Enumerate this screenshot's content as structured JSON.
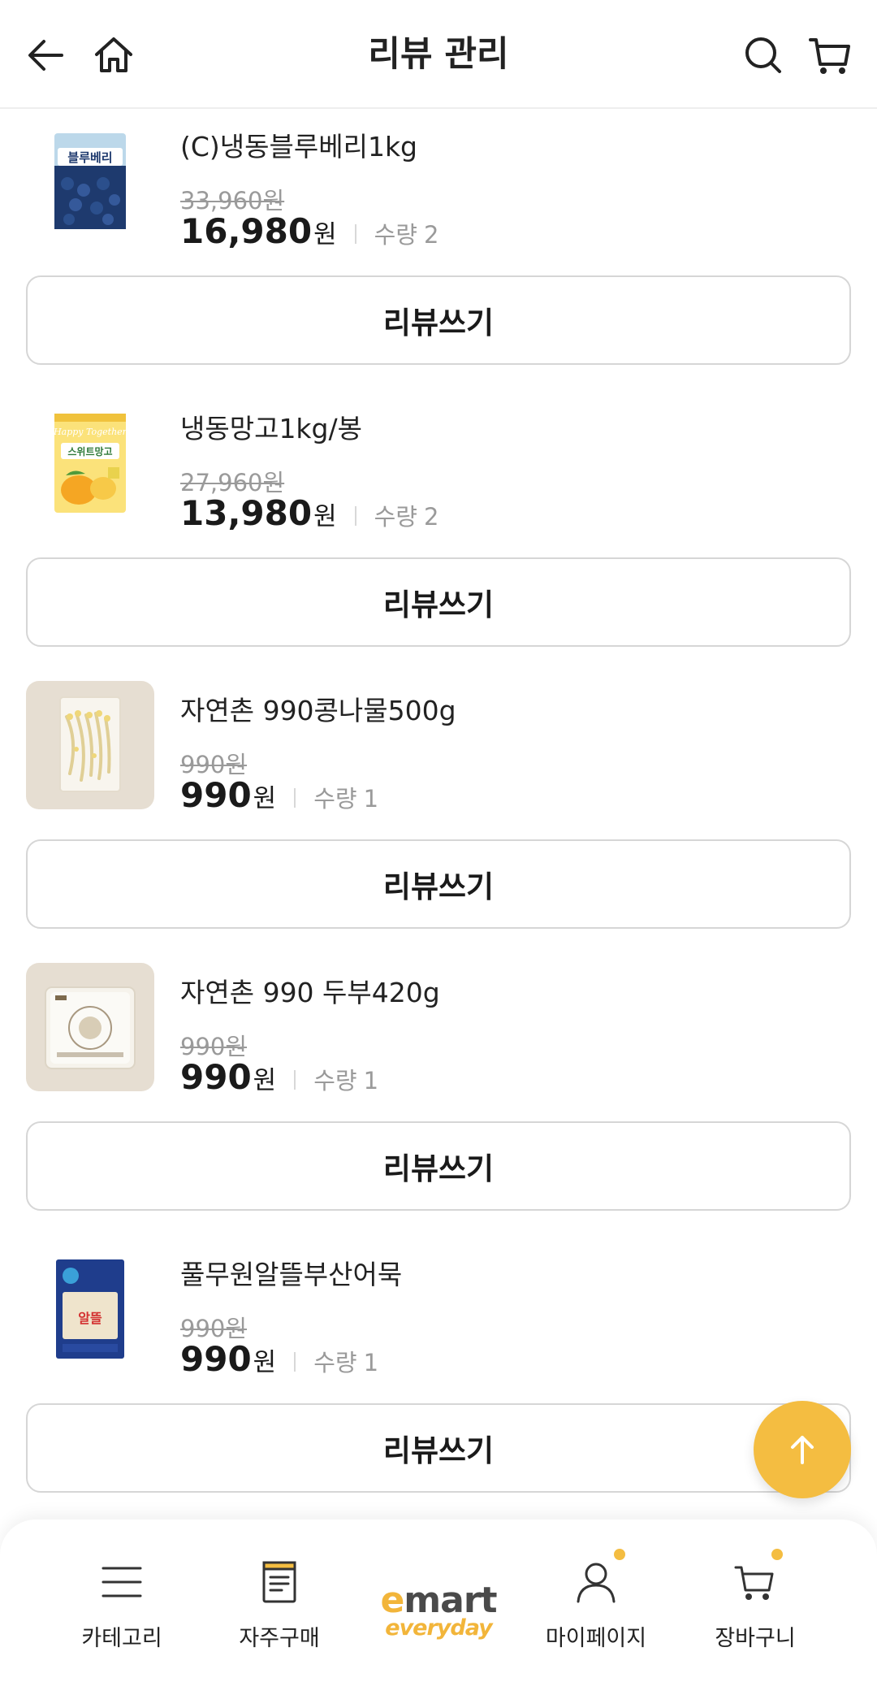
{
  "header": {
    "title": "리뷰 관리"
  },
  "products": [
    {
      "name": "(C)냉동블루베리1kg",
      "original_price": "33,960원",
      "price": "16,980",
      "won": "원",
      "qty_label": "수량",
      "qty": "2",
      "review_label": "리뷰쓰기",
      "package_text": "블루베리"
    },
    {
      "name": "냉동망고1kg/봉",
      "original_price": "27,960원",
      "price": "13,980",
      "won": "원",
      "qty_label": "수량",
      "qty": "2",
      "review_label": "리뷰쓰기",
      "package_text": "스위트망고"
    },
    {
      "name": "자연촌 990콩나물500g",
      "original_price": "990원",
      "price": "990",
      "won": "원",
      "qty_label": "수량",
      "qty": "1",
      "review_label": "리뷰쓰기"
    },
    {
      "name": "자연촌 990 두부420g",
      "original_price": "990원",
      "price": "990",
      "won": "원",
      "qty_label": "수량",
      "qty": "1",
      "review_label": "리뷰쓰기"
    },
    {
      "name": "풀무원알뜰부산어묵",
      "original_price": "990원",
      "price": "990",
      "won": "원",
      "qty_label": "수량",
      "qty": "1",
      "review_label": "리뷰쓰기",
      "package_text": "알뜰"
    }
  ],
  "bottom_nav": {
    "category": "카테고리",
    "frequent": "자주구매",
    "logo_top": "emart",
    "logo_bottom": "everyday",
    "mypage": "마이페이지",
    "cart": "장바구니"
  },
  "colors": {
    "accent": "#f4bd41",
    "text": "#1a1a1a",
    "muted": "#9a9a9a",
    "border": "#d6d6d6"
  }
}
